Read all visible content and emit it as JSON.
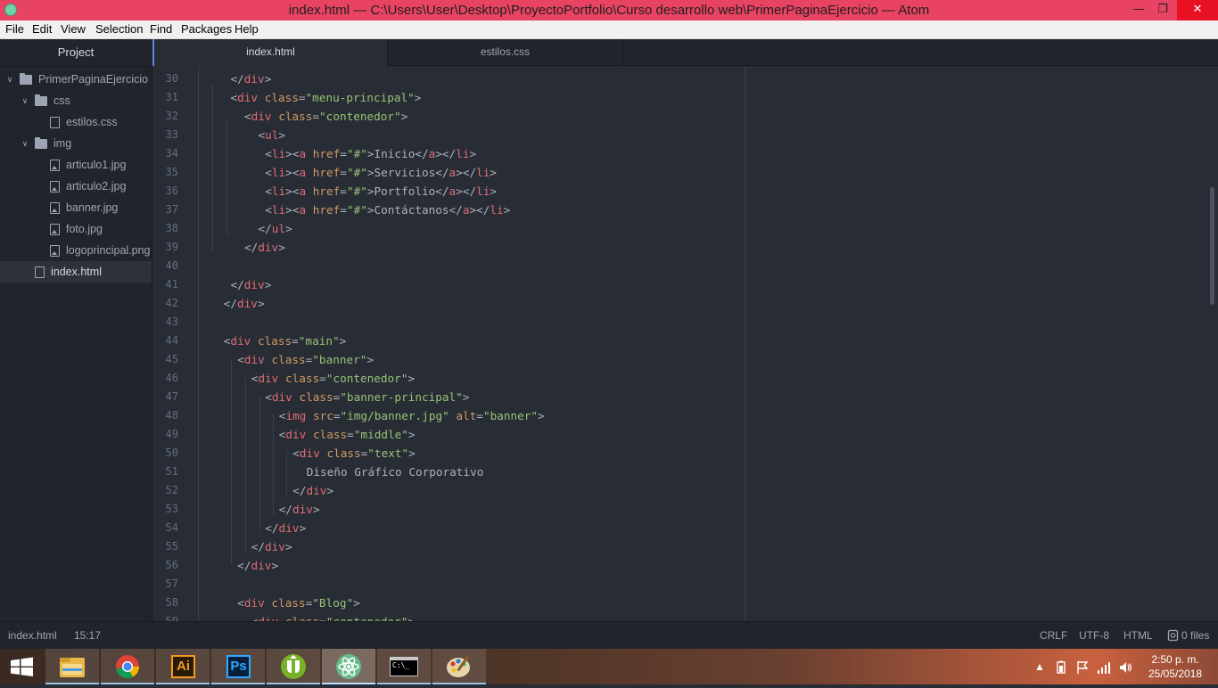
{
  "window": {
    "title": "index.html — C:\\Users\\User\\Desktop\\ProyectoPortfolio\\Curso desarrollo web\\PrimerPaginaEjercicio — Atom",
    "minimize": "—",
    "maximize": "❐",
    "close": "✕"
  },
  "menu": [
    "File",
    "Edit",
    "View",
    "Selection",
    "Find",
    "Packages",
    "Help"
  ],
  "tree": {
    "header": "Project",
    "items": [
      {
        "label": "PrimerPaginaEjercicio",
        "kind": "folder",
        "depth": 0,
        "expanded": true
      },
      {
        "label": "css",
        "kind": "folder",
        "depth": 1,
        "expanded": true
      },
      {
        "label": "estilos.css",
        "kind": "file",
        "depth": 2
      },
      {
        "label": "img",
        "kind": "folder",
        "depth": 1,
        "expanded": true
      },
      {
        "label": "articulo1.jpg",
        "kind": "image",
        "depth": 2
      },
      {
        "label": "articulo2.jpg",
        "kind": "image",
        "depth": 2
      },
      {
        "label": "banner.jpg",
        "kind": "image",
        "depth": 2
      },
      {
        "label": "foto.jpg",
        "kind": "image",
        "depth": 2
      },
      {
        "label": "logoprincipal.png",
        "kind": "image",
        "depth": 2
      },
      {
        "label": "index.html",
        "kind": "file",
        "depth": 1,
        "selected": true
      }
    ]
  },
  "tabs": [
    {
      "label": "index.html",
      "active": true
    },
    {
      "label": "estilos.css",
      "active": false
    }
  ],
  "editor": {
    "lines": [
      {
        "n": "30",
        "indent": 1,
        "text": "</div>"
      },
      {
        "n": "31",
        "indent": 1,
        "text": "<div class=\"menu-principal\">"
      },
      {
        "n": "32",
        "indent": 2,
        "text": "<div class=\"contenedor\">"
      },
      {
        "n": "33",
        "indent": 3,
        "text": "<ul>"
      },
      {
        "n": "34",
        "indent": 3.5,
        "text": "<li><a href=\"#\">Inicio</a></li>"
      },
      {
        "n": "35",
        "indent": 3.5,
        "text": "<li><a href=\"#\">Servicios</a></li>"
      },
      {
        "n": "36",
        "indent": 3.5,
        "text": "<li><a href=\"#\">Portfolio</a></li>"
      },
      {
        "n": "37",
        "indent": 3.5,
        "text": "<li><a href=\"#\">Contáctanos</a></li>"
      },
      {
        "n": "38",
        "indent": 3,
        "text": "</ul>"
      },
      {
        "n": "39",
        "indent": 2,
        "text": "</div>"
      },
      {
        "n": "40",
        "indent": 0,
        "text": ""
      },
      {
        "n": "41",
        "indent": 1,
        "text": "</div>"
      },
      {
        "n": "42",
        "indent": 0.5,
        "text": "</div>"
      },
      {
        "n": "43",
        "indent": 0,
        "text": ""
      },
      {
        "n": "44",
        "indent": 0.5,
        "text": "<div class=\"main\">"
      },
      {
        "n": "45",
        "indent": 1.5,
        "text": "<div class=\"banner\">"
      },
      {
        "n": "46",
        "indent": 2.5,
        "text": "<div class=\"contenedor\">"
      },
      {
        "n": "47",
        "indent": 3.5,
        "text": "<div class=\"banner-principal\">"
      },
      {
        "n": "48",
        "indent": 4.5,
        "text": "<img src=\"img/banner.jpg\" alt=\"banner\">"
      },
      {
        "n": "49",
        "indent": 4.5,
        "text": "<div class=\"middle\">"
      },
      {
        "n": "50",
        "indent": 5.5,
        "text": "<div class=\"text\">"
      },
      {
        "n": "51",
        "indent": 6.5,
        "text": "Diseño Gráfico Corporativo"
      },
      {
        "n": "52",
        "indent": 5.5,
        "text": "</div>"
      },
      {
        "n": "53",
        "indent": 4.5,
        "text": "</div>"
      },
      {
        "n": "54",
        "indent": 3.5,
        "text": "</div>"
      },
      {
        "n": "55",
        "indent": 2.5,
        "text": "</div>"
      },
      {
        "n": "56",
        "indent": 1.5,
        "text": "</div>"
      },
      {
        "n": "57",
        "indent": 0,
        "text": ""
      },
      {
        "n": "58",
        "indent": 1.5,
        "text": "<div class=\"Blog\">"
      },
      {
        "n": "59",
        "indent": 2.5,
        "text": "<div class=\"contenedor\">"
      }
    ]
  },
  "status": {
    "file": "index.html",
    "cursor": "15:17",
    "line_ending": "CRLF",
    "encoding": "UTF-8",
    "grammar": "HTML",
    "git": "0 files"
  },
  "taskbar": {
    "apps": [
      "windows-start",
      "file-explorer",
      "chrome",
      "illustrator",
      "photoshop",
      "utorrent",
      "atom",
      "command-prompt",
      "paint"
    ],
    "ai_label": "Ai",
    "ps_label": "Ps",
    "cmd_label": "C:\\_",
    "time": "2:50 p. m.",
    "date": "25/05/2018"
  },
  "colors": {
    "editor_bg": "#282c34",
    "panel_bg": "#21252b",
    "tag": "#e06c75",
    "attr": "#d19a66",
    "string": "#98c379",
    "text": "#abb2bf",
    "line_number": "#636d83",
    "accent": "#568af2"
  }
}
